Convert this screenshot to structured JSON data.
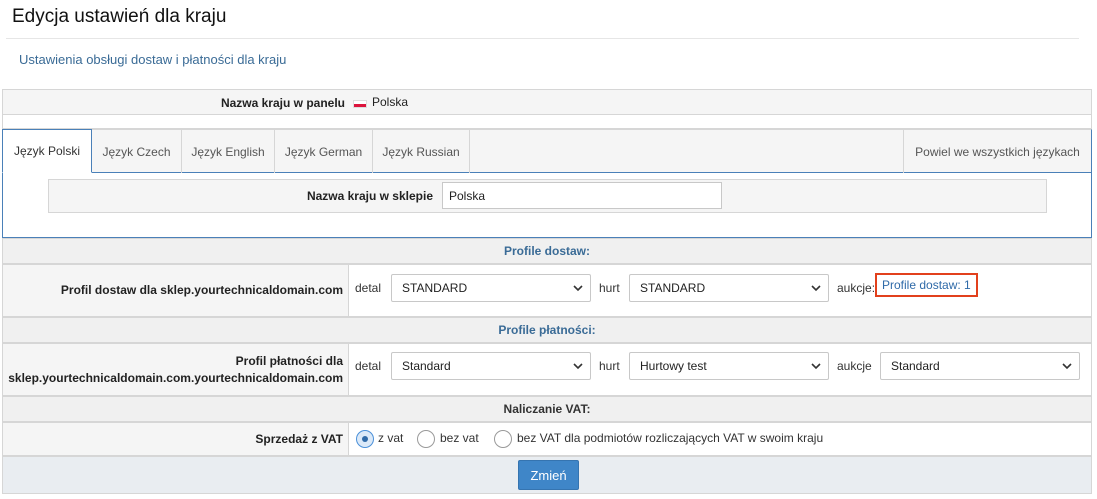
{
  "page": {
    "title": "Edycja ustawień dla kraju",
    "subtitle": "Ustawienia obsługi dostaw i płatności dla kraju"
  },
  "country": {
    "panel_label": "Nazwa kraju w panelu",
    "panel_value": "Polska",
    "flag_colors": [
      "#ffffff",
      "#dc143c"
    ]
  },
  "tabs": [
    {
      "label": "Język Polski",
      "active": true
    },
    {
      "label": "Język Czech",
      "active": false
    },
    {
      "label": "Język English",
      "active": false
    },
    {
      "label": "Język German",
      "active": false
    },
    {
      "label": "Język Russian",
      "active": false
    }
  ],
  "copy_all_label": "Powiel we wszystkich językach",
  "shop_name": {
    "label": "Nazwa kraju w sklepie",
    "value": "Polska"
  },
  "delivery": {
    "header": "Profile dostaw:",
    "label": "Profil dostaw dla sklep.yourtechnicaldomain.com",
    "detal_label": "detal",
    "detal_value": "STANDARD",
    "hurt_label": "hurt",
    "hurt_value": "STANDARD",
    "aukcje_label": "aukcje:",
    "aukcje_link": "Profile dostaw: 1"
  },
  "payment": {
    "header": "Profile płatności:",
    "label_line1": "Profil płatności dla",
    "label_line2": "sklep.yourtechnicaldomain.com.yourtechnicaldomain.com",
    "detal_label": "detal",
    "detal_value": "Standard",
    "hurt_label": "hurt",
    "hurt_value": "Hurtowy test",
    "aukcje_label": "aukcje",
    "aukcje_value": "Standard"
  },
  "vat": {
    "header": "Naliczanie VAT:",
    "label": "Sprzedaż z VAT",
    "options": [
      {
        "label": "z vat",
        "checked": true
      },
      {
        "label": "bez vat",
        "checked": false
      },
      {
        "label": "bez VAT dla podmiotów rozliczających VAT w swoim kraju",
        "checked": false
      }
    ]
  },
  "submit_label": "Zmień",
  "colors": {
    "accent": "#3f86c8",
    "link": "#2f6aa8",
    "highlight_border": "#e2401c"
  }
}
